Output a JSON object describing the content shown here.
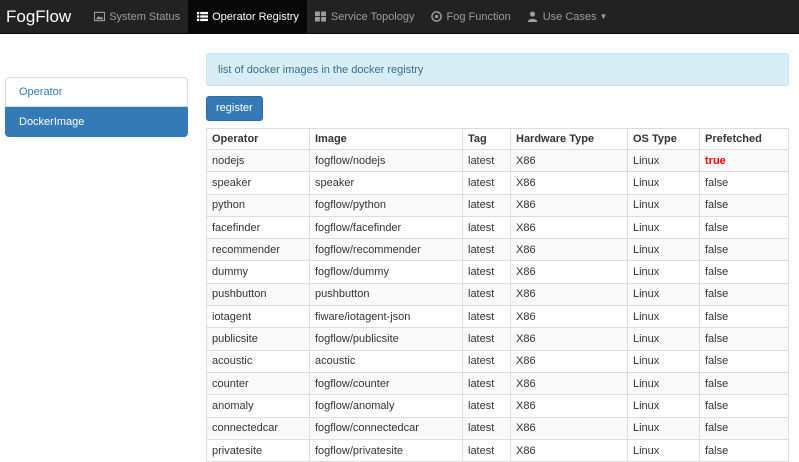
{
  "navbar": {
    "brand": "FogFlow",
    "items": [
      {
        "label": "System Status",
        "icon": "picture-icon"
      },
      {
        "label": "Operator Registry",
        "icon": "list-icon",
        "active": true
      },
      {
        "label": "Service Topology",
        "icon": "grid-icon"
      },
      {
        "label": "Fog Function",
        "icon": "function-icon"
      },
      {
        "label": "Use Cases",
        "icon": "user-icon"
      }
    ]
  },
  "sidebar": {
    "items": [
      {
        "label": "Operator"
      },
      {
        "label": "DockerImage",
        "active": true
      }
    ]
  },
  "main": {
    "info_text": "list of docker images in the docker registry",
    "register_label": "register",
    "columns": [
      "Operator",
      "Image",
      "Tag",
      "Hardware Type",
      "OS Type",
      "Prefetched"
    ],
    "rows": [
      [
        "nodejs",
        "fogflow/nodejs",
        "latest",
        "X86",
        "Linux",
        "true"
      ],
      [
        "speaker",
        "speaker",
        "latest",
        "X86",
        "Linux",
        "false"
      ],
      [
        "python",
        "fogflow/python",
        "latest",
        "X86",
        "Linux",
        "false"
      ],
      [
        "facefinder",
        "fogflow/facefinder",
        "latest",
        "X86",
        "Linux",
        "false"
      ],
      [
        "recommender",
        "fogflow/recommender",
        "latest",
        "X86",
        "Linux",
        "false"
      ],
      [
        "dummy",
        "fogflow/dummy",
        "latest",
        "X86",
        "Linux",
        "false"
      ],
      [
        "pushbutton",
        "pushbutton",
        "latest",
        "X86",
        "Linux",
        "false"
      ],
      [
        "iotagent",
        "fiware/iotagent-json",
        "latest",
        "X86",
        "Linux",
        "false"
      ],
      [
        "publicsite",
        "fogflow/publicsite",
        "latest",
        "X86",
        "Linux",
        "false"
      ],
      [
        "acoustic",
        "acoustic",
        "latest",
        "X86",
        "Linux",
        "false"
      ],
      [
        "counter",
        "fogflow/counter",
        "latest",
        "X86",
        "Linux",
        "false"
      ],
      [
        "anomaly",
        "fogflow/anomaly",
        "latest",
        "X86",
        "Linux",
        "false"
      ],
      [
        "connectedcar",
        "fogflow/connectedcar",
        "latest",
        "X86",
        "Linux",
        "false"
      ],
      [
        "privatesite",
        "fogflow/privatesite",
        "latest",
        "X86",
        "Linux",
        "false"
      ]
    ]
  },
  "colors": {
    "navbar": "#222222",
    "primary": "#337ab7",
    "info_bg": "#d9edf7",
    "true_text": "#ff0000"
  }
}
